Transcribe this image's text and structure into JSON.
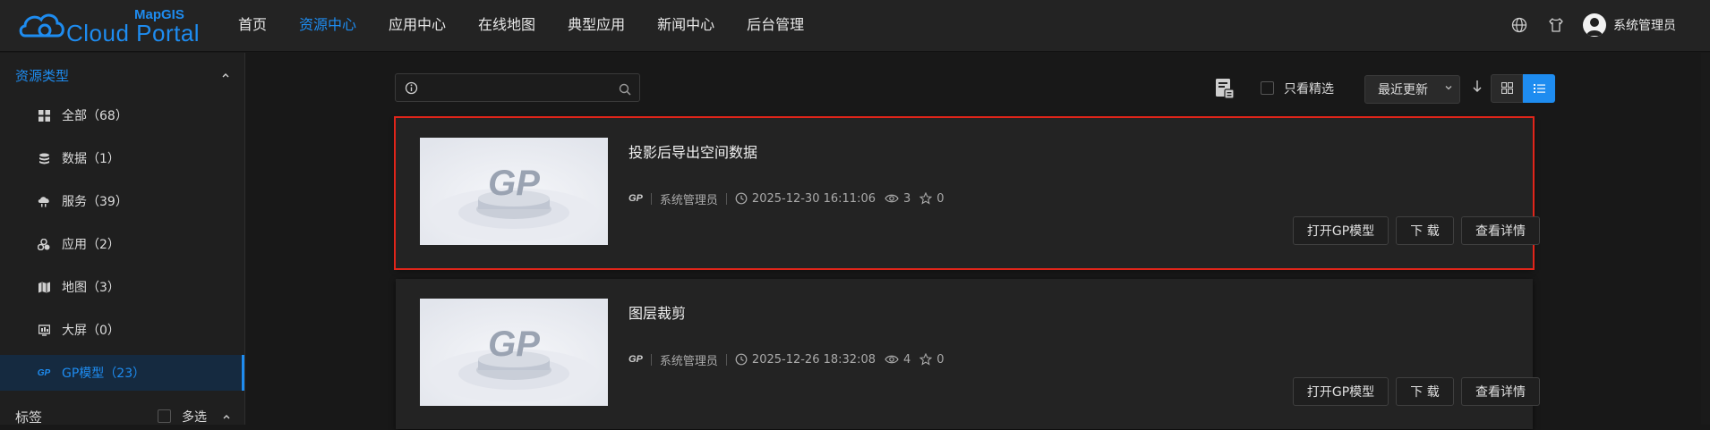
{
  "header": {
    "logo_top": "MapGIS",
    "logo_main": "Cloud Portal",
    "nav": [
      {
        "label": "首页",
        "active": false
      },
      {
        "label": "资源中心",
        "active": true
      },
      {
        "label": "应用中心",
        "active": false
      },
      {
        "label": "在线地图",
        "active": false
      },
      {
        "label": "典型应用",
        "active": false
      },
      {
        "label": "新闻中心",
        "active": false
      },
      {
        "label": "后台管理",
        "active": false
      }
    ],
    "user_name": "系统管理员"
  },
  "sidebar": {
    "title": "资源类型",
    "items": [
      {
        "label": "全部（68）",
        "icon": "grid-icon"
      },
      {
        "label": "数据（1）",
        "icon": "database-icon"
      },
      {
        "label": "服务（39）",
        "icon": "cloud-service-icon"
      },
      {
        "label": "应用（2）",
        "icon": "app-icon"
      },
      {
        "label": "地图（3）",
        "icon": "map-icon"
      },
      {
        "label": "大屏（0）",
        "icon": "screen-icon"
      },
      {
        "label": "GP模型（23）",
        "icon": "gp-icon",
        "active": true
      }
    ],
    "tags_title": "标签",
    "multi_label": "多选"
  },
  "toolbar": {
    "search_placeholder": "",
    "only_featured": "只看精选",
    "sort_label": "最近更新"
  },
  "cards": [
    {
      "title": "投影后导出空间数据",
      "type": "GP",
      "owner": "系统管理员",
      "date": "2025-12-30 16:11:06",
      "views": "3",
      "stars": "0",
      "btn_open": "打开GP模型",
      "btn_download": "下 载",
      "btn_detail": "查看详情"
    },
    {
      "title": "图层裁剪",
      "type": "GP",
      "owner": "系统管理员",
      "date": "2025-12-26 18:32:08",
      "views": "4",
      "stars": "0",
      "btn_open": "打开GP模型",
      "btn_download": "下 载",
      "btn_detail": "查看详情"
    }
  ],
  "colors": {
    "accent": "#1e8cf0",
    "highlight": "#e0251a",
    "background": "#181818"
  }
}
